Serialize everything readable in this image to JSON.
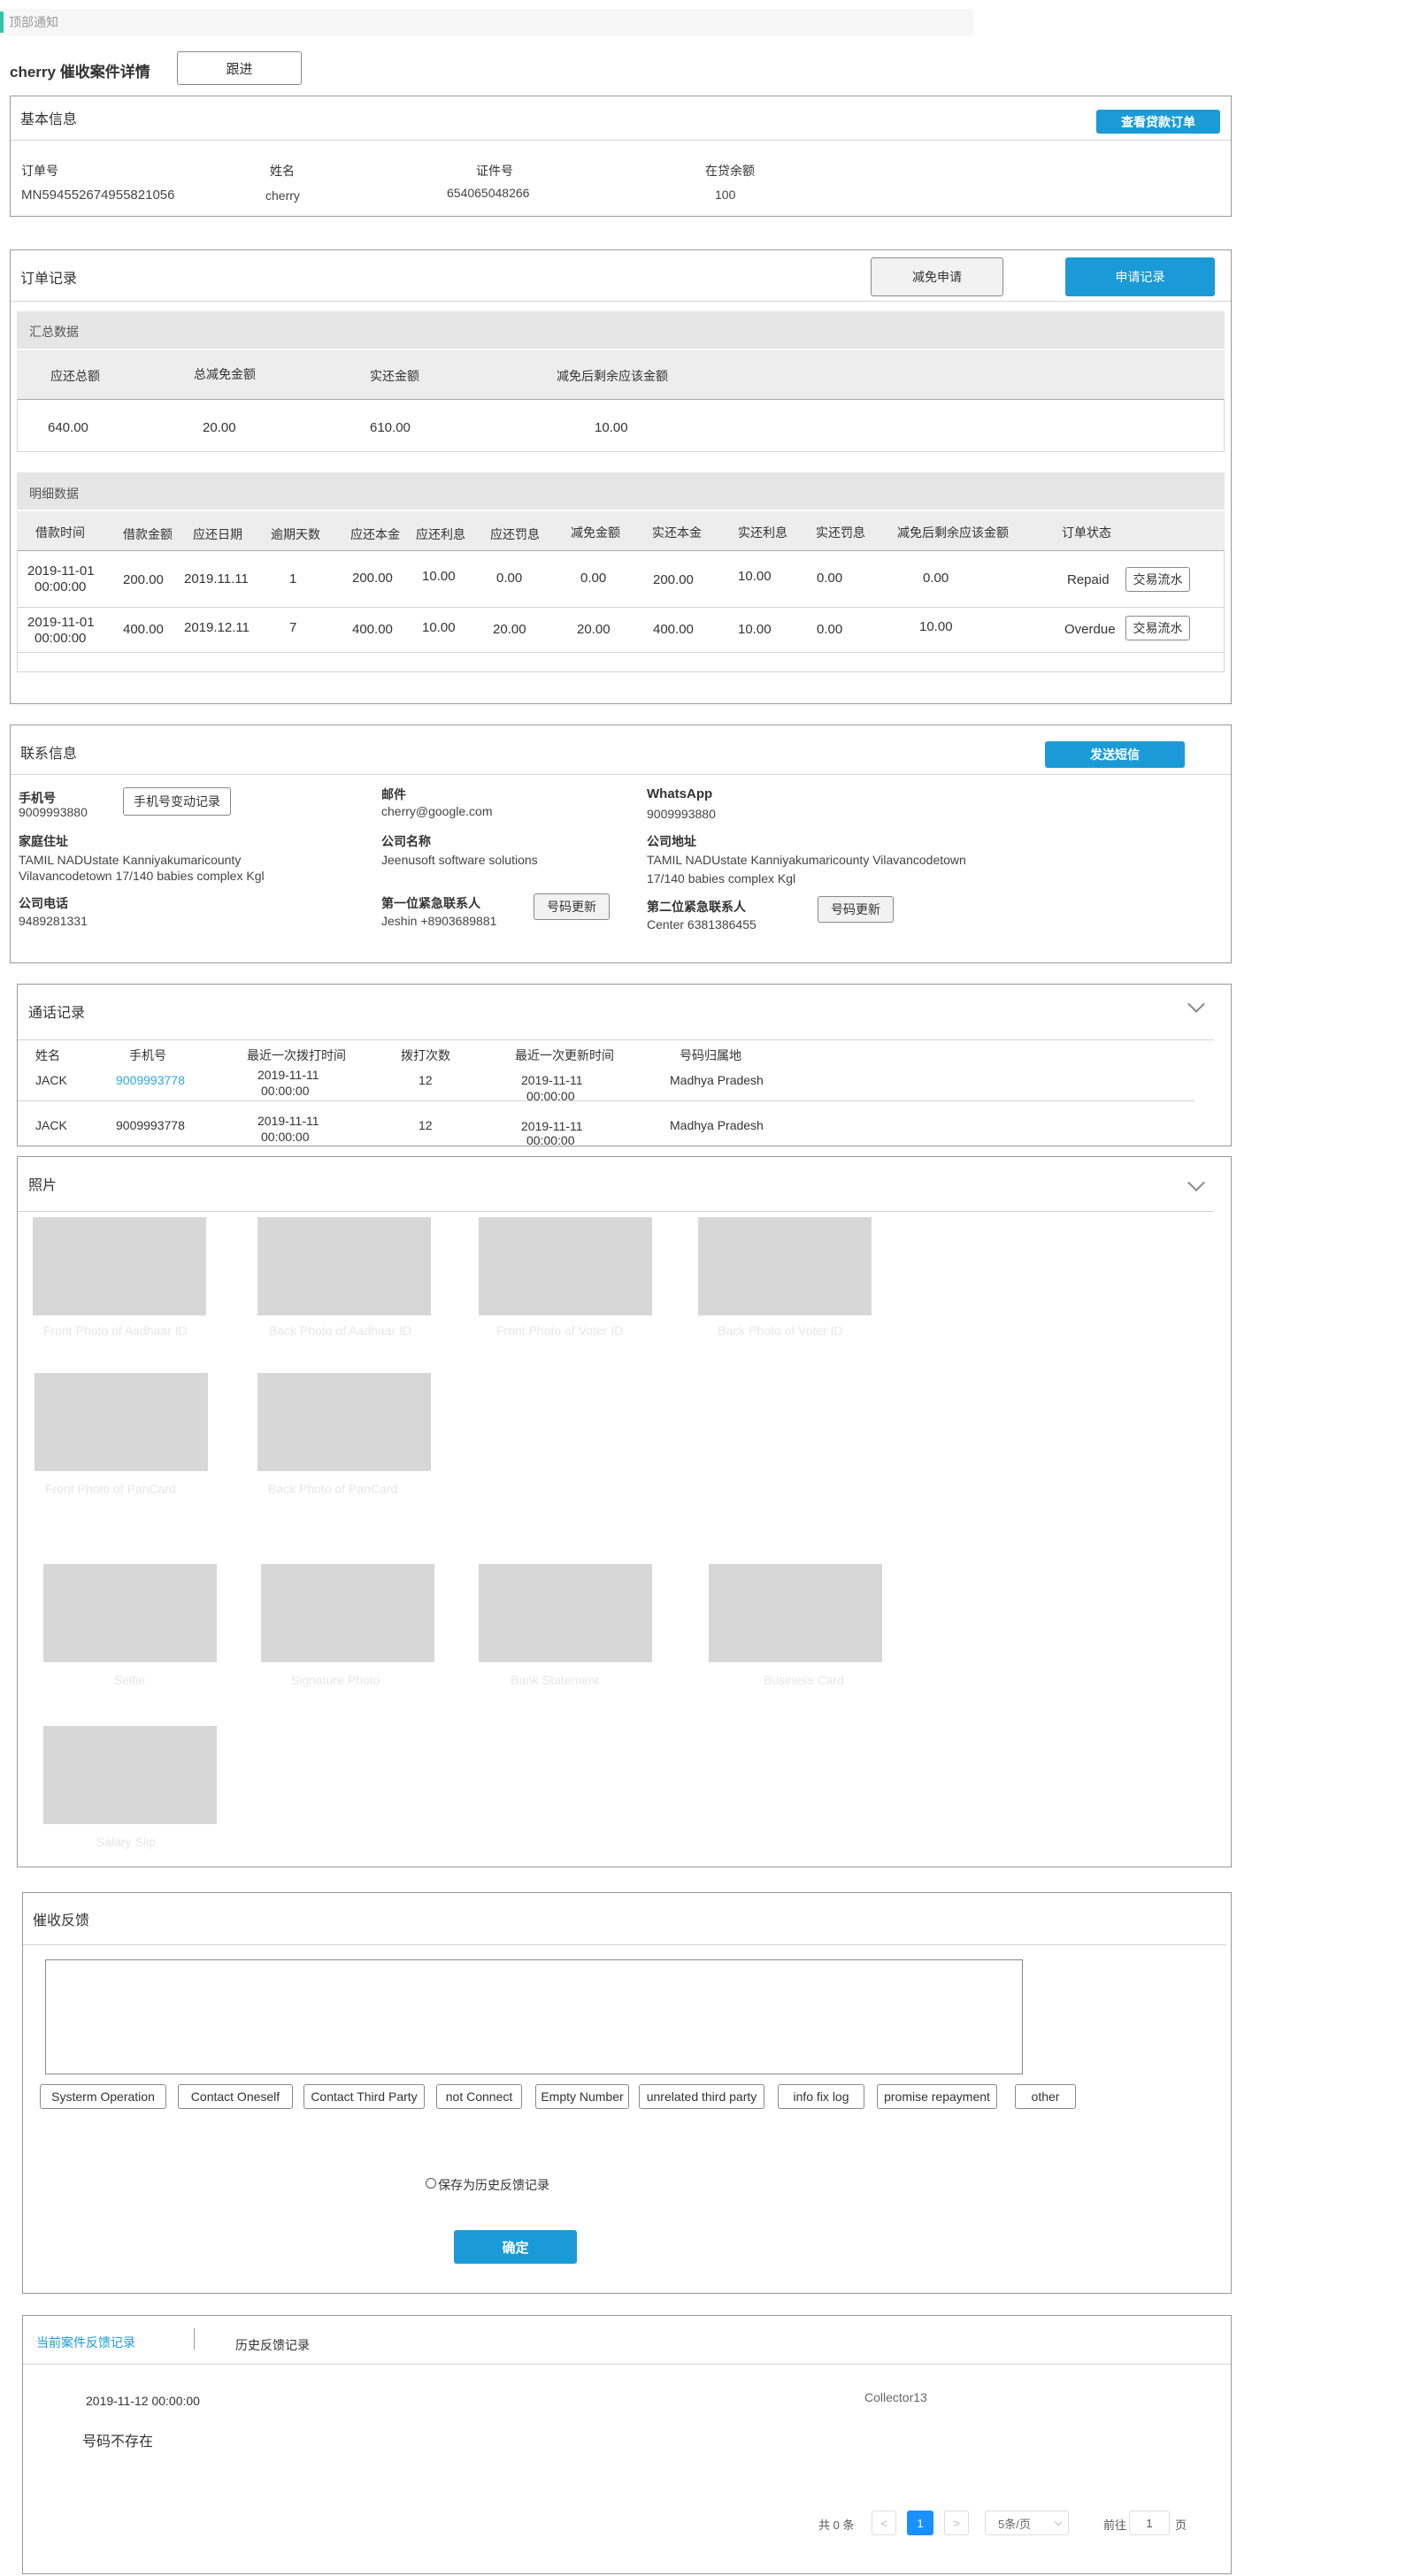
{
  "top_notice": "顶部通知",
  "header": {
    "title": "cherry 催收案件详情",
    "follow_button": "跟进"
  },
  "basic_info": {
    "title": "基本信息",
    "view_loan_button": "查看贷款订单",
    "fields": [
      {
        "label": "订单号",
        "value": "MN594552674955821056"
      },
      {
        "label": "姓名",
        "value": "cherry"
      },
      {
        "label": "证件号",
        "value": "654065048266"
      },
      {
        "label": "在贷余额",
        "value": "100"
      }
    ]
  },
  "order_record": {
    "title": "订单记录",
    "waiver_button": "减免申请",
    "apply_record_button": "申请记录",
    "summary": {
      "title": "汇总数据",
      "headers": [
        "应还总额",
        "总减免金额",
        "实还金额",
        "减免后剩余应该金额"
      ],
      "values": [
        "640.00",
        "20.00",
        "610.00",
        "10.00"
      ]
    },
    "detail": {
      "title": "明细数据",
      "headers": [
        "借款时间",
        "借款金额",
        "应还日期",
        "逾期天数",
        "应还本金",
        "应还利息",
        "应还罚息",
        "减免金额",
        "实还本金",
        "实还利息",
        "实还罚息",
        "减免后剩余应该金额",
        "订单状态"
      ],
      "rows": [
        {
          "loan_date": "2019-11-01",
          "loan_time": "00:00:00",
          "amount": "200.00",
          "due_date": "2019.11.11",
          "overdue_days": "1",
          "principal": "200.00",
          "interest": "10.00",
          "penalty": "0.00",
          "waiver": "0.00",
          "paid_principal": "200.00",
          "paid_interest": "10.00",
          "paid_penalty": "0.00",
          "remaining": "0.00",
          "status": "Repaid",
          "flow_button": "交易流水"
        },
        {
          "loan_date": "2019-11-01",
          "loan_time": "00:00:00",
          "amount": "400.00",
          "due_date": "2019.12.11",
          "overdue_days": "7",
          "principal": "400.00",
          "interest": "10.00",
          "penalty": "20.00",
          "waiver": "20.00",
          "paid_principal": "400.00",
          "paid_interest": "10.00",
          "paid_penalty": "0.00",
          "remaining": "10.00",
          "status": "Overdue",
          "flow_button": "交易流水"
        }
      ]
    }
  },
  "contact": {
    "title": "联系信息",
    "sms_button": "发送短信",
    "phone_label": "手机号",
    "phone": "9009993880",
    "phone_change_button": "手机号变动记录",
    "email_label": "邮件",
    "email": "cherry@google.com",
    "whatsapp_label": "WhatsApp",
    "whatsapp": "9009993880",
    "home_label": "家庭住址",
    "home_line1": "TAMIL NADUstate Kanniyakumaricounty",
    "home_line2": "Vilavancodetown 17/140 babies complex Kgl",
    "company_label": "公司名称",
    "company": "Jeenusoft software solutions",
    "company_addr_label": "公司地址",
    "company_addr_line1": "TAMIL NADUstate Kanniyakumaricounty Vilavancodetown",
    "company_addr_line2": "17/140 babies complex Kgl",
    "company_phone_label": "公司电话",
    "company_phone": "9489281331",
    "emergency1_label": "第一位紧急联系人",
    "emergency1": "Jeshin +8903689881",
    "emergency2_label": "第二位紧急联系人",
    "emergency2": "Center 6381386455",
    "update_button": "号码更新"
  },
  "calls": {
    "title": "通话记录",
    "headers": [
      "姓名",
      "手机号",
      "最近一次拨打时间",
      "拨打次数",
      "最近一次更新时间",
      "号码归属地"
    ],
    "rows": [
      {
        "name": "JACK",
        "phone": "9009993778",
        "last_call_date": "2019-11-11",
        "last_call_time": "00:00:00",
        "count": "12",
        "update_date": "2019-11-11",
        "update_time": "00:00:00",
        "region": "Madhya Pradesh"
      },
      {
        "name": "JACK",
        "phone": "9009993778",
        "last_call_date": "2019-11-11",
        "last_call_time": "00:00:00",
        "count": "12",
        "update_date": "2019-11-11",
        "update_time": "00:00:00",
        "region": "Madhya Pradesh"
      }
    ]
  },
  "photos": {
    "title": "照片",
    "captions": [
      "Front Photo of Aadhaar ID",
      "Back Photo of Aadhaar ID",
      "Front Photo of Voter ID",
      "Back Photo of Voter ID",
      "Front Photo of PanCard",
      "Back Photo of PanCard",
      "Selfie",
      "Signature Photo",
      "Bank Statement",
      "Business Card",
      "Salary Slip"
    ]
  },
  "feedback": {
    "title": "催收反馈",
    "tags": [
      "Systerm Operation",
      "Contact Oneself",
      "Contact Third Party",
      "not Connect",
      "Empty Number",
      "unrelated third party",
      "info fix log",
      "promise repayment",
      "other"
    ],
    "save_history_label": "保存为历史反馈记录",
    "confirm_button": "确定"
  },
  "records": {
    "tab_current": "当前案件反馈记录",
    "tab_history": "历史反馈记录",
    "datetime": "2019-11-12  00:00:00",
    "collector": "Collector13",
    "content": "号码不存在",
    "total": "共 0 条",
    "prev": "<",
    "page": "1",
    "next": ">",
    "page_size": "5条/页",
    "goto_label": "前往",
    "goto_value": "1",
    "page_unit": "页"
  },
  "colors": {
    "accent": "#1a9bd7",
    "link": "#2ea7e0",
    "page_active": "#1890ff",
    "notice_bar": "#2ec7a6"
  }
}
